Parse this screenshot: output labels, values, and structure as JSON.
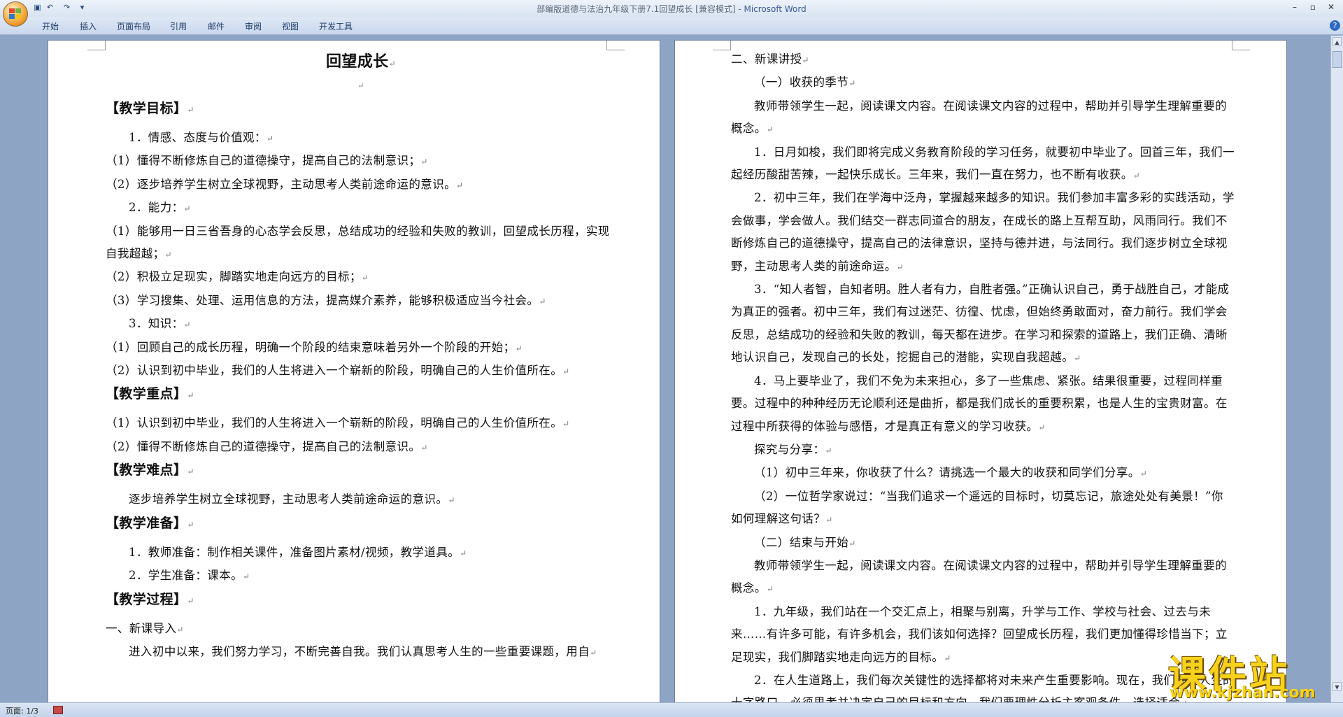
{
  "window": {
    "title_doc": "部编版道德与法治九年级下册7.1回望成长 [兼容模式] - ",
    "title_app": "Microsoft Word",
    "minimize_icon": "minimize-icon",
    "maximize_icon": "maximize-icon",
    "close_icon": "close-icon"
  },
  "quick_access": {
    "undo": "↶",
    "redo": "↷",
    "more": "▾"
  },
  "ribbon": {
    "tabs": [
      {
        "label": "开始"
      },
      {
        "label": "插入"
      },
      {
        "label": "页面布局"
      },
      {
        "label": "引用"
      },
      {
        "label": "邮件"
      },
      {
        "label": "审阅"
      },
      {
        "label": "视图"
      },
      {
        "label": "开发工具"
      }
    ],
    "help": "?"
  },
  "page1": {
    "title": "回望成长",
    "para_mark": "↵",
    "h_goal": "【教学目标】",
    "g1": "1．情感、态度与价值观：",
    "g1_1": "（1）懂得不断修炼自己的道德操守，提高自己的法制意识；",
    "g1_2": "（2）逐步培养学生树立全球视野，主动思考人类前途命运的意识。",
    "g2": "2．能力：",
    "g2_1": "（1）能够用一日三省吾身的心态学会反思，总结成功的经验和失败的教训，回望成长历程，实现自我超越；",
    "g2_2": "（2）积极立足现实，脚踏实地走向远方的目标；",
    "g2_3": "（3）学习搜集、处理、运用信息的方法，提高媒介素养，能够积极适应当今社会。",
    "g3": "3．知识：",
    "g3_1": "（1）回顾自己的成长历程，明确一个阶段的结束意味着另外一个阶段的开始；",
    "g3_2": "（2）认识到初中毕业，我们的人生将进入一个崭新的阶段，明确自己的人生价值所在。",
    "h_key": "【教学重点】",
    "k1": "（1）认识到初中毕业，我们的人生将进入一个崭新的阶段，明确自己的人生价值所在。",
    "k2": "（2）懂得不断修炼自己的道德操守，提高自己的法制意识。",
    "h_diff": "【教学难点】",
    "d1": "逐步培养学生树立全球视野，主动思考人类前途命运的意识。",
    "h_prep": "【教学准备】",
    "p1": "1．教师准备：制作相关课件，准备图片素材/视频，教学道具。",
    "p2": "2．学生准备：课本。",
    "h_proc": "【教学过程】",
    "s1": "一、新课导入",
    "s1_text": "进入初中以来，我们努力学习，不断完善自我。我们认真思考人生的一些重要课题，用自"
  },
  "page2": {
    "sec2": "二、新课讲授",
    "sub1": "（一）收获的季节",
    "intro1": "教师带领学生一起，阅读课文内容。在阅读课文内容的过程中，帮助并引导学生理解重要的概念。",
    "n1": "1．日月如梭，我们即将完成义务教育阶段的学习任务，就要初中毕业了。回首三年，我们一起经历酸甜苦辣，一起快乐成长。三年来，我们一直在努力，也不断有收获。",
    "n2": "2．初中三年，我们在学海中泛舟，掌握越来越多的知识。我们参加丰富多彩的实践活动，学会做事，学会做人。我们结交一群志同道合的朋友，在成长的路上互帮互助，风雨同行。我们不断修炼自己的道德操守，提高自己的法律意识，坚持与德并进，与法同行。我们逐步树立全球视野，主动思考人类的前途命运。",
    "n3": "3．“知人者智，自知者明。胜人者有力，自胜者强。”正确认识自己，勇于战胜自己，才能成为真正的强者。初中三年，我们有过迷茫、彷徨、忧虑，但始终勇敢面对，奋力前行。我们学会反思，总结成功的经验和失败的教训，每天都在进步。在学习和探索的道路上，我们正确、清晰地认识自己，发现自己的长处，挖掘自己的潜能，实现自我超越。",
    "n4": "4．马上要毕业了，我们不免为未来担心，多了一些焦虑、紧张。结果很重要，过程同样重要。过程中的种种经历无论顺利还是曲折，都是我们成长的重要积累，也是人生的宝贵财富。在过程中所获得的体验与感悟，才是真正有意义的学习收获。",
    "explore": "探究与分享：",
    "e1": "（1）初中三年来，你收获了什么？请挑选一个最大的收获和同学们分享。",
    "e2": "（2）一位哲学家说过：“当我们追求一个遥远的目标时，切莫忘记，旅途处处有美景！”你如何理解这句话？",
    "sub2": "（二）结束与开始",
    "intro2": "教师带领学生一起，阅读课文内容。在阅读课文内容的过程中，帮助并引导学生理解重要的概念。",
    "m1": "1．九年级，我们站在一个交汇点上，相聚与别离，升学与工作、学校与社会、过去与未来……有许多可能，有许多机会，我们该如何选择？回望成长历程，我们更加懂得珍惜当下；立足现实，我们脚踏实地走向远方的目标。",
    "m2": "2．在人生道路上，我们每次关键性的选择都将对未来产生重要影响。现在，我们站在人生的十字路口，必须思考并决定自己的目标和方向。我们要理性分析主客观条件，选择适合"
  },
  "status": {
    "page": "页面: 1/3"
  },
  "watermark": {
    "brand": "课件站",
    "url": "www.kjzhan.com"
  },
  "colors": {
    "title_app": "#3a5a99",
    "workspace": "#8ea4c4",
    "watermark": "#f7d21b"
  }
}
